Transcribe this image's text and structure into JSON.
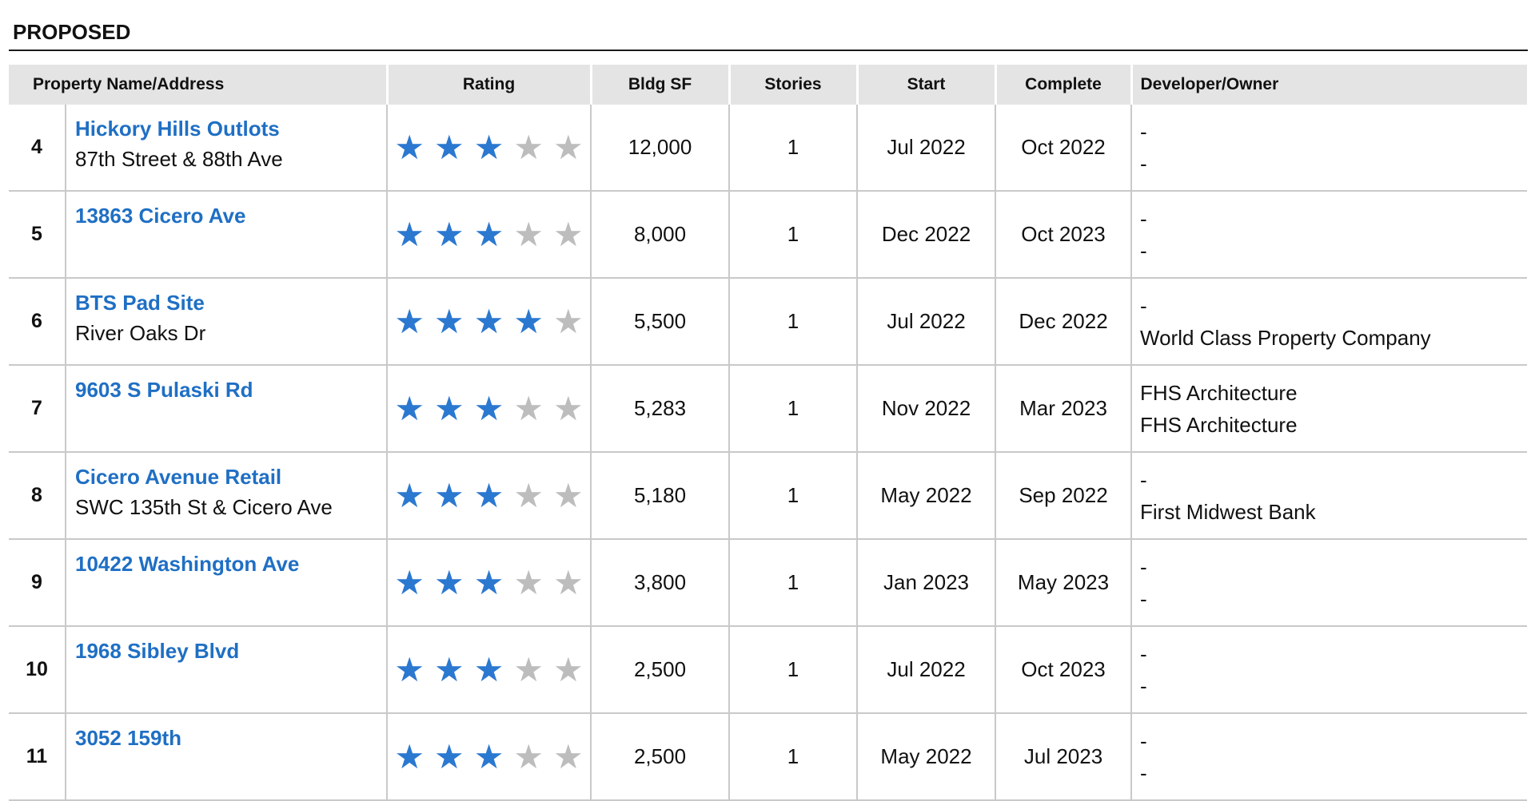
{
  "section_title": "PROPOSED",
  "colors": {
    "link": "#1f6fc4",
    "star_on": "#2b78d0",
    "star_off": "#bdbdbd"
  },
  "columns": {
    "name": "Property Name/Address",
    "rating": "Rating",
    "bldg_sf": "Bldg SF",
    "stories": "Stories",
    "start": "Start",
    "complete": "Complete",
    "developer": "Developer/Owner"
  },
  "rows": [
    {
      "num": "4",
      "name": "Hickory Hills Outlots",
      "address": "87th Street & 88th Ave",
      "rating": 3,
      "bldg_sf": "12,000",
      "stories": "1",
      "start": "Jul 2022",
      "complete": "Oct 2022",
      "developer": "-",
      "owner": "-"
    },
    {
      "num": "5",
      "name": "13863 Cicero Ave",
      "address": "",
      "rating": 3,
      "bldg_sf": "8,000",
      "stories": "1",
      "start": "Dec 2022",
      "complete": "Oct 2023",
      "developer": "-",
      "owner": "-"
    },
    {
      "num": "6",
      "name": "BTS Pad Site",
      "address": "River Oaks Dr",
      "rating": 4,
      "bldg_sf": "5,500",
      "stories": "1",
      "start": "Jul 2022",
      "complete": "Dec 2022",
      "developer": "-",
      "owner": "World Class Property Company"
    },
    {
      "num": "7",
      "name": "9603 S Pulaski Rd",
      "address": "",
      "rating": 3,
      "bldg_sf": "5,283",
      "stories": "1",
      "start": "Nov 2022",
      "complete": "Mar 2023",
      "developer": "FHS Architecture",
      "owner": "FHS Architecture"
    },
    {
      "num": "8",
      "name": "Cicero Avenue Retail",
      "address": "SWC 135th St & Cicero Ave",
      "rating": 3,
      "bldg_sf": "5,180",
      "stories": "1",
      "start": "May 2022",
      "complete": "Sep 2022",
      "developer": "-",
      "owner": "First Midwest Bank"
    },
    {
      "num": "9",
      "name": "10422 Washington Ave",
      "address": "",
      "rating": 3,
      "bldg_sf": "3,800",
      "stories": "1",
      "start": "Jan 2023",
      "complete": "May 2023",
      "developer": "-",
      "owner": "-"
    },
    {
      "num": "10",
      "name": "1968 Sibley Blvd",
      "address": "",
      "rating": 3,
      "bldg_sf": "2,500",
      "stories": "1",
      "start": "Jul 2022",
      "complete": "Oct 2023",
      "developer": "-",
      "owner": "-"
    },
    {
      "num": "11",
      "name": "3052 159th",
      "address": "",
      "rating": 3,
      "bldg_sf": "2,500",
      "stories": "1",
      "start": "May 2022",
      "complete": "Jul 2023",
      "developer": "-",
      "owner": "-"
    }
  ]
}
